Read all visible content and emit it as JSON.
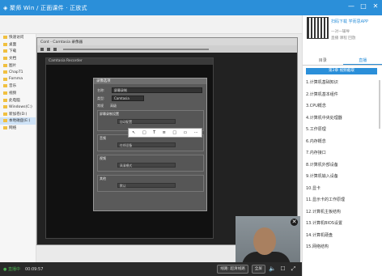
{
  "titlebar": {
    "title": "◈ 聚师 Win / 正面课件 · 正放式",
    "controls": [
      "—",
      "□",
      "✕"
    ]
  },
  "explorer": {
    "items": [
      "快速访问",
      "桌面",
      "下载",
      "文档",
      "图片",
      "ChapT1",
      "Fomma",
      "音乐",
      "视频",
      "此电脑",
      "Windows(C:)",
      "新加卷(D:)",
      "本地磁盘(E:)",
      "网络"
    ],
    "selected_index": 12
  },
  "camtasia": {
    "title": "Cont - Camtasia 录像器",
    "inner_title": "Camtasia Recorder",
    "dialog": {
      "title": "录像选项",
      "name_label": "名称:",
      "name_value": "屏幕录制",
      "type_label": "类型:",
      "type_value": "Camtasia",
      "tabs": [
        "常规",
        "高级"
      ],
      "group1": "屏幕录制设置",
      "group1_sel": "自动配置",
      "group2": "音频",
      "group2_sel": "在线设备",
      "group3": "视频",
      "group3_sel": "高清模式",
      "group4": "其他",
      "group4_sel": "默认"
    },
    "tooltip": [
      "↖",
      "□",
      "T",
      "≡",
      "□",
      "▭",
      "⋯"
    ]
  },
  "pip": {
    "close": "✕"
  },
  "controlbar": {
    "live": "● 直播中",
    "time": "00:09:57",
    "btn_line": "线路: 超清线路",
    "btn_fullscreen": "全屏",
    "icons": [
      "volume-icon",
      "chat-icon",
      "fullscreen-icon"
    ]
  },
  "sidebar": {
    "app_text": "扫码下载 学而思APP",
    "login_text": "一对一辅导",
    "sub_text": "直播 课程 回放",
    "tabs": [
      "目录",
      "直播"
    ],
    "active_tab": 1,
    "chapter_head": "第2章 视频截取",
    "chapters": [
      "1.计算机基础知识",
      "2.计算机基本组件",
      "3.CPU概念",
      "4.计算机中央处理器",
      "5.工作原理",
      "6.内存概念",
      "7.内存接口",
      "8.计算机外部设备",
      "9.计算机输入设备",
      "10.显卡",
      "11.显示卡的工作原理",
      "12.计算机主板结构",
      "13.计算机BIOS设置",
      "14.计算机硬盘",
      "15.网络结构"
    ]
  }
}
